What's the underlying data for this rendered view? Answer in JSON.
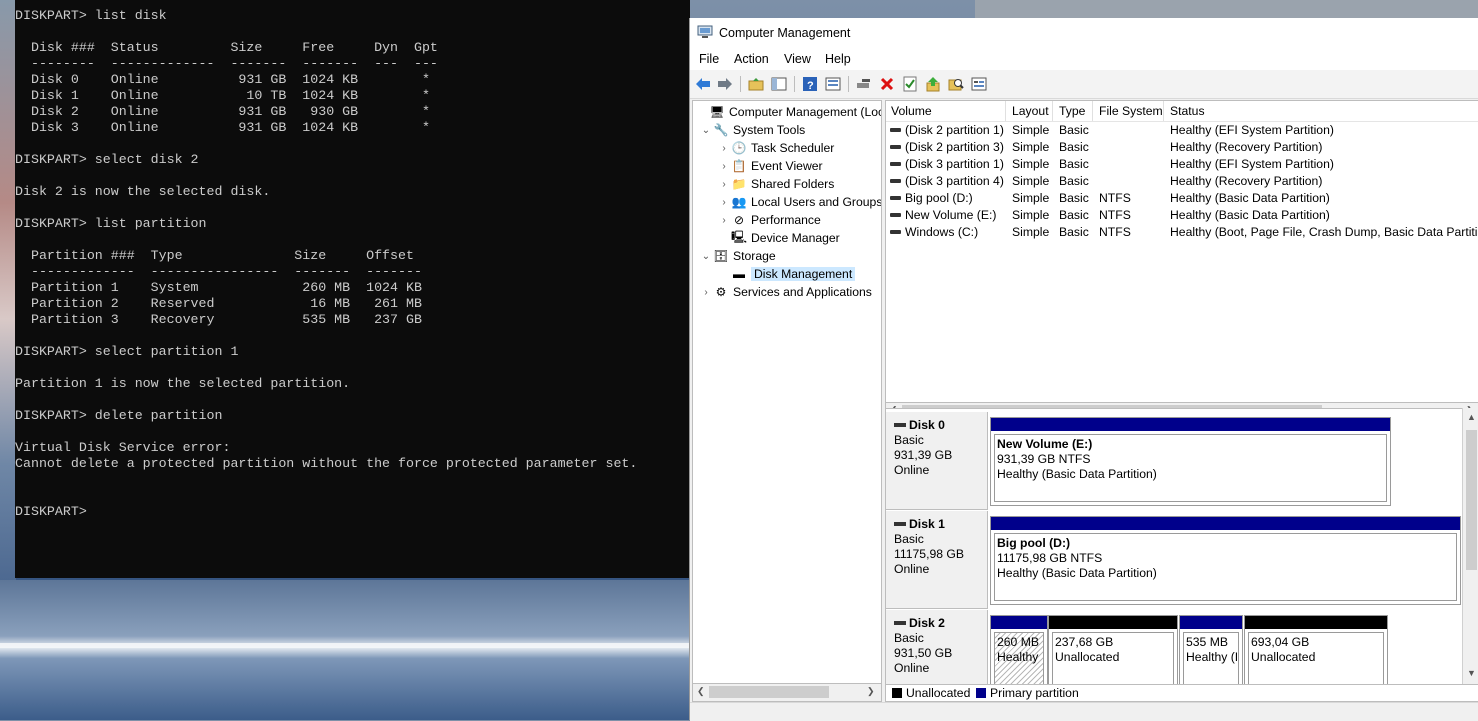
{
  "console": {
    "text": "DISKPART> list disk\n\n  Disk ###  Status         Size     Free     Dyn  Gpt\n  --------  -------------  -------  -------  ---  ---\n  Disk 0    Online          931 GB  1024 KB        *\n  Disk 1    Online           10 TB  1024 KB        *\n  Disk 2    Online          931 GB   930 GB        *\n  Disk 3    Online          931 GB  1024 KB        *\n\nDISKPART> select disk 2\n\nDisk 2 is now the selected disk.\n\nDISKPART> list partition\n\n  Partition ###  Type              Size     Offset\n  -------------  ----------------  -------  -------\n  Partition 1    System             260 MB  1024 KB\n  Partition 2    Reserved            16 MB   261 MB\n  Partition 3    Recovery           535 MB   237 GB\n\nDISKPART> select partition 1\n\nPartition 1 is now the selected partition.\n\nDISKPART> delete partition\n\nVirtual Disk Service error:\nCannot delete a protected partition without the force protected parameter set.\n\n\nDISKPART> "
  },
  "window": {
    "title": "Computer Management",
    "menu": [
      "File",
      "Action",
      "View",
      "Help"
    ]
  },
  "tree": [
    {
      "label": "Computer Management (Local",
      "icon": "computer-icon",
      "exp": ""
    },
    {
      "label": "System Tools",
      "icon": "tools-icon",
      "exp": "⌄"
    },
    {
      "label": "Task Scheduler",
      "icon": "clock-icon",
      "exp": "›"
    },
    {
      "label": "Event Viewer",
      "icon": "event-viewer-icon",
      "exp": "›"
    },
    {
      "label": "Shared Folders",
      "icon": "shared-folder-icon",
      "exp": "›"
    },
    {
      "label": "Local Users and Groups",
      "icon": "users-icon",
      "exp": "›"
    },
    {
      "label": "Performance",
      "icon": "performance-icon",
      "exp": "›"
    },
    {
      "label": "Device Manager",
      "icon": "device-manager-icon",
      "exp": ""
    },
    {
      "label": "Storage",
      "icon": "storage-icon",
      "exp": "⌄"
    },
    {
      "label": "Disk Management",
      "icon": "disk-icon",
      "exp": ""
    },
    {
      "label": "Services and Applications",
      "icon": "services-icon",
      "exp": "›"
    }
  ],
  "volume_columns": [
    "Volume",
    "Layout",
    "Type",
    "File System",
    "Status"
  ],
  "volumes": [
    {
      "volume": "(Disk 2 partition 1)",
      "layout": "Simple",
      "type": "Basic",
      "fs": "",
      "status": "Healthy (EFI System Partition)"
    },
    {
      "volume": "(Disk 2 partition 3)",
      "layout": "Simple",
      "type": "Basic",
      "fs": "",
      "status": "Healthy (Recovery Partition)"
    },
    {
      "volume": "(Disk 3 partition 1)",
      "layout": "Simple",
      "type": "Basic",
      "fs": "",
      "status": "Healthy (EFI System Partition)"
    },
    {
      "volume": "(Disk 3 partition 4)",
      "layout": "Simple",
      "type": "Basic",
      "fs": "",
      "status": "Healthy (Recovery Partition)"
    },
    {
      "volume": "Big pool (D:)",
      "layout": "Simple",
      "type": "Basic",
      "fs": "NTFS",
      "status": "Healthy (Basic Data Partition)"
    },
    {
      "volume": "New Volume (E:)",
      "layout": "Simple",
      "type": "Basic",
      "fs": "NTFS",
      "status": "Healthy (Basic Data Partition)"
    },
    {
      "volume": "Windows (C:)",
      "layout": "Simple",
      "type": "Basic",
      "fs": "NTFS",
      "status": "Healthy (Boot, Page File, Crash Dump, Basic Data Partition)"
    }
  ],
  "disks": [
    {
      "name": "Disk 0",
      "type": "Basic",
      "size": "931,39 GB",
      "state": "Online",
      "partitions": [
        {
          "kind": "primary",
          "title": "New Volume  (E:)",
          "line2": "931,39 GB NTFS",
          "line3": "Healthy (Basic Data Partition)"
        }
      ]
    },
    {
      "name": "Disk 1",
      "type": "Basic",
      "size": "11175,98 GB",
      "state": "Online",
      "partitions": [
        {
          "kind": "primary",
          "title": "Big pool  (D:)",
          "line2": "11175,98 GB NTFS",
          "line3": "Healthy (Basic Data Partition)"
        }
      ]
    },
    {
      "name": "Disk 2",
      "type": "Basic",
      "size": "931,50 GB",
      "state": "Online",
      "partitions": [
        {
          "kind": "primary-selected",
          "title": "260 MB",
          "line2": "Healthy"
        },
        {
          "kind": "unallocated",
          "title": "237,68 GB",
          "line2": "Unallocated"
        },
        {
          "kind": "primary",
          "title": "535 MB",
          "line2": "Healthy (I"
        },
        {
          "kind": "unallocated",
          "title": "693,04 GB",
          "line2": "Unallocated"
        }
      ]
    }
  ],
  "legend": [
    {
      "label": "Unallocated",
      "color": "#000000"
    },
    {
      "label": "Primary partition",
      "color": "#00008b"
    }
  ],
  "colors": {
    "primary": "#00008b",
    "unallocated": "#000000",
    "console_bg": "#0c0c0c"
  }
}
